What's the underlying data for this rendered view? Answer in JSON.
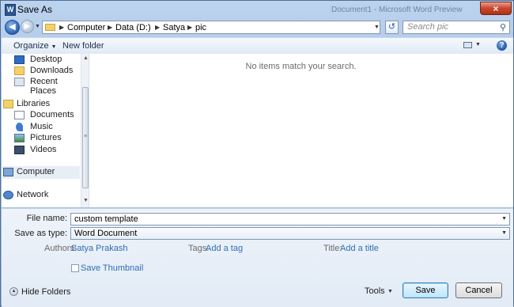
{
  "window": {
    "title": "Save As",
    "background_title": "Document1 - Microsoft Word Preview",
    "close_label": "×"
  },
  "address": {
    "breadcrumbs": [
      "Computer",
      "Data (D:)",
      "Satya",
      "pic"
    ],
    "search_placeholder": "Search pic"
  },
  "toolbar": {
    "organize_label": "Organize",
    "new_folder_label": "New folder"
  },
  "nav": {
    "favorites": [
      "Desktop",
      "Downloads",
      "Recent Places"
    ],
    "libraries_label": "Libraries",
    "libraries": [
      "Documents",
      "Music",
      "Pictures",
      "Videos"
    ],
    "computer_label": "Computer",
    "network_label": "Network"
  },
  "file_area": {
    "empty_message": "No items match your search."
  },
  "form": {
    "file_name_label": "File name:",
    "file_name_value": "custom template",
    "save_type_label": "Save as type:",
    "save_type_value": "Word Document",
    "authors_label": "Authors:",
    "authors_value": "Satya Prakash",
    "tags_label": "Tags:",
    "tags_value": "Add a tag",
    "title_label": "Title:",
    "title_value": "Add a title",
    "thumbnail_label": "Save Thumbnail",
    "thumbnail_checked": false
  },
  "footer": {
    "hide_folders_label": "Hide Folders",
    "tools_label": "Tools",
    "save_label": "Save",
    "cancel_label": "Cancel"
  }
}
